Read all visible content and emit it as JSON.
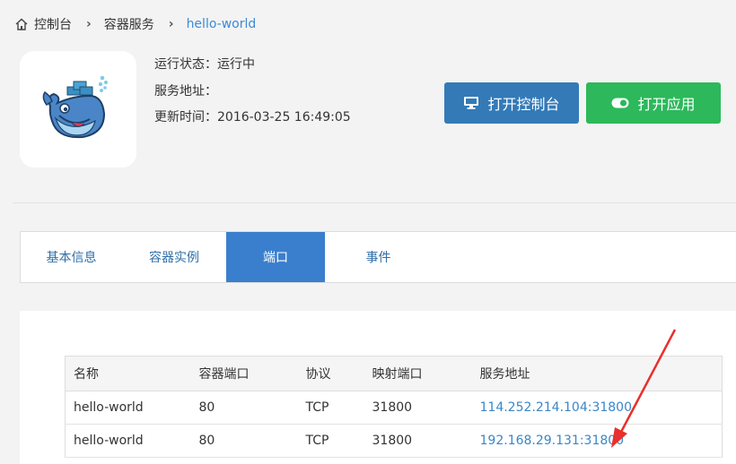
{
  "breadcrumb": {
    "home": "控制台",
    "section": "容器服务",
    "current": "hello-world"
  },
  "service": {
    "status_label": "运行状态：",
    "status_value": "运行中",
    "address_label": "服务地址：",
    "address_value": "",
    "updated_label": "更新时间：",
    "updated_value": "2016-03-25 16:49:05"
  },
  "actions": {
    "open_console": "打开控制台",
    "open_app": "打开应用"
  },
  "tabs": [
    {
      "label": "基本信息",
      "active": false
    },
    {
      "label": "容器实例",
      "active": false
    },
    {
      "label": "端口",
      "active": true
    },
    {
      "label": "事件",
      "active": false
    }
  ],
  "ports_table": {
    "headers": [
      "名称",
      "容器端口",
      "协议",
      "映射端口",
      "服务地址"
    ],
    "rows": [
      [
        "hello-world",
        "80",
        "TCP",
        "31800",
        "114.252.214.104:31800"
      ],
      [
        "hello-world",
        "80",
        "TCP",
        "31800",
        "192.168.29.131:31800"
      ]
    ]
  },
  "colors": {
    "primary_button": "#337ab7",
    "success_button": "#2cb85b",
    "active_tab": "#3a7fcd",
    "link": "#3a86c8",
    "annotation_arrow": "#e8302c"
  },
  "icons": {
    "breadcrumb": "home-icon",
    "console_button": "monitor-icon",
    "app_button": "toggle-on-icon",
    "logo": "docker-whale-logo"
  }
}
